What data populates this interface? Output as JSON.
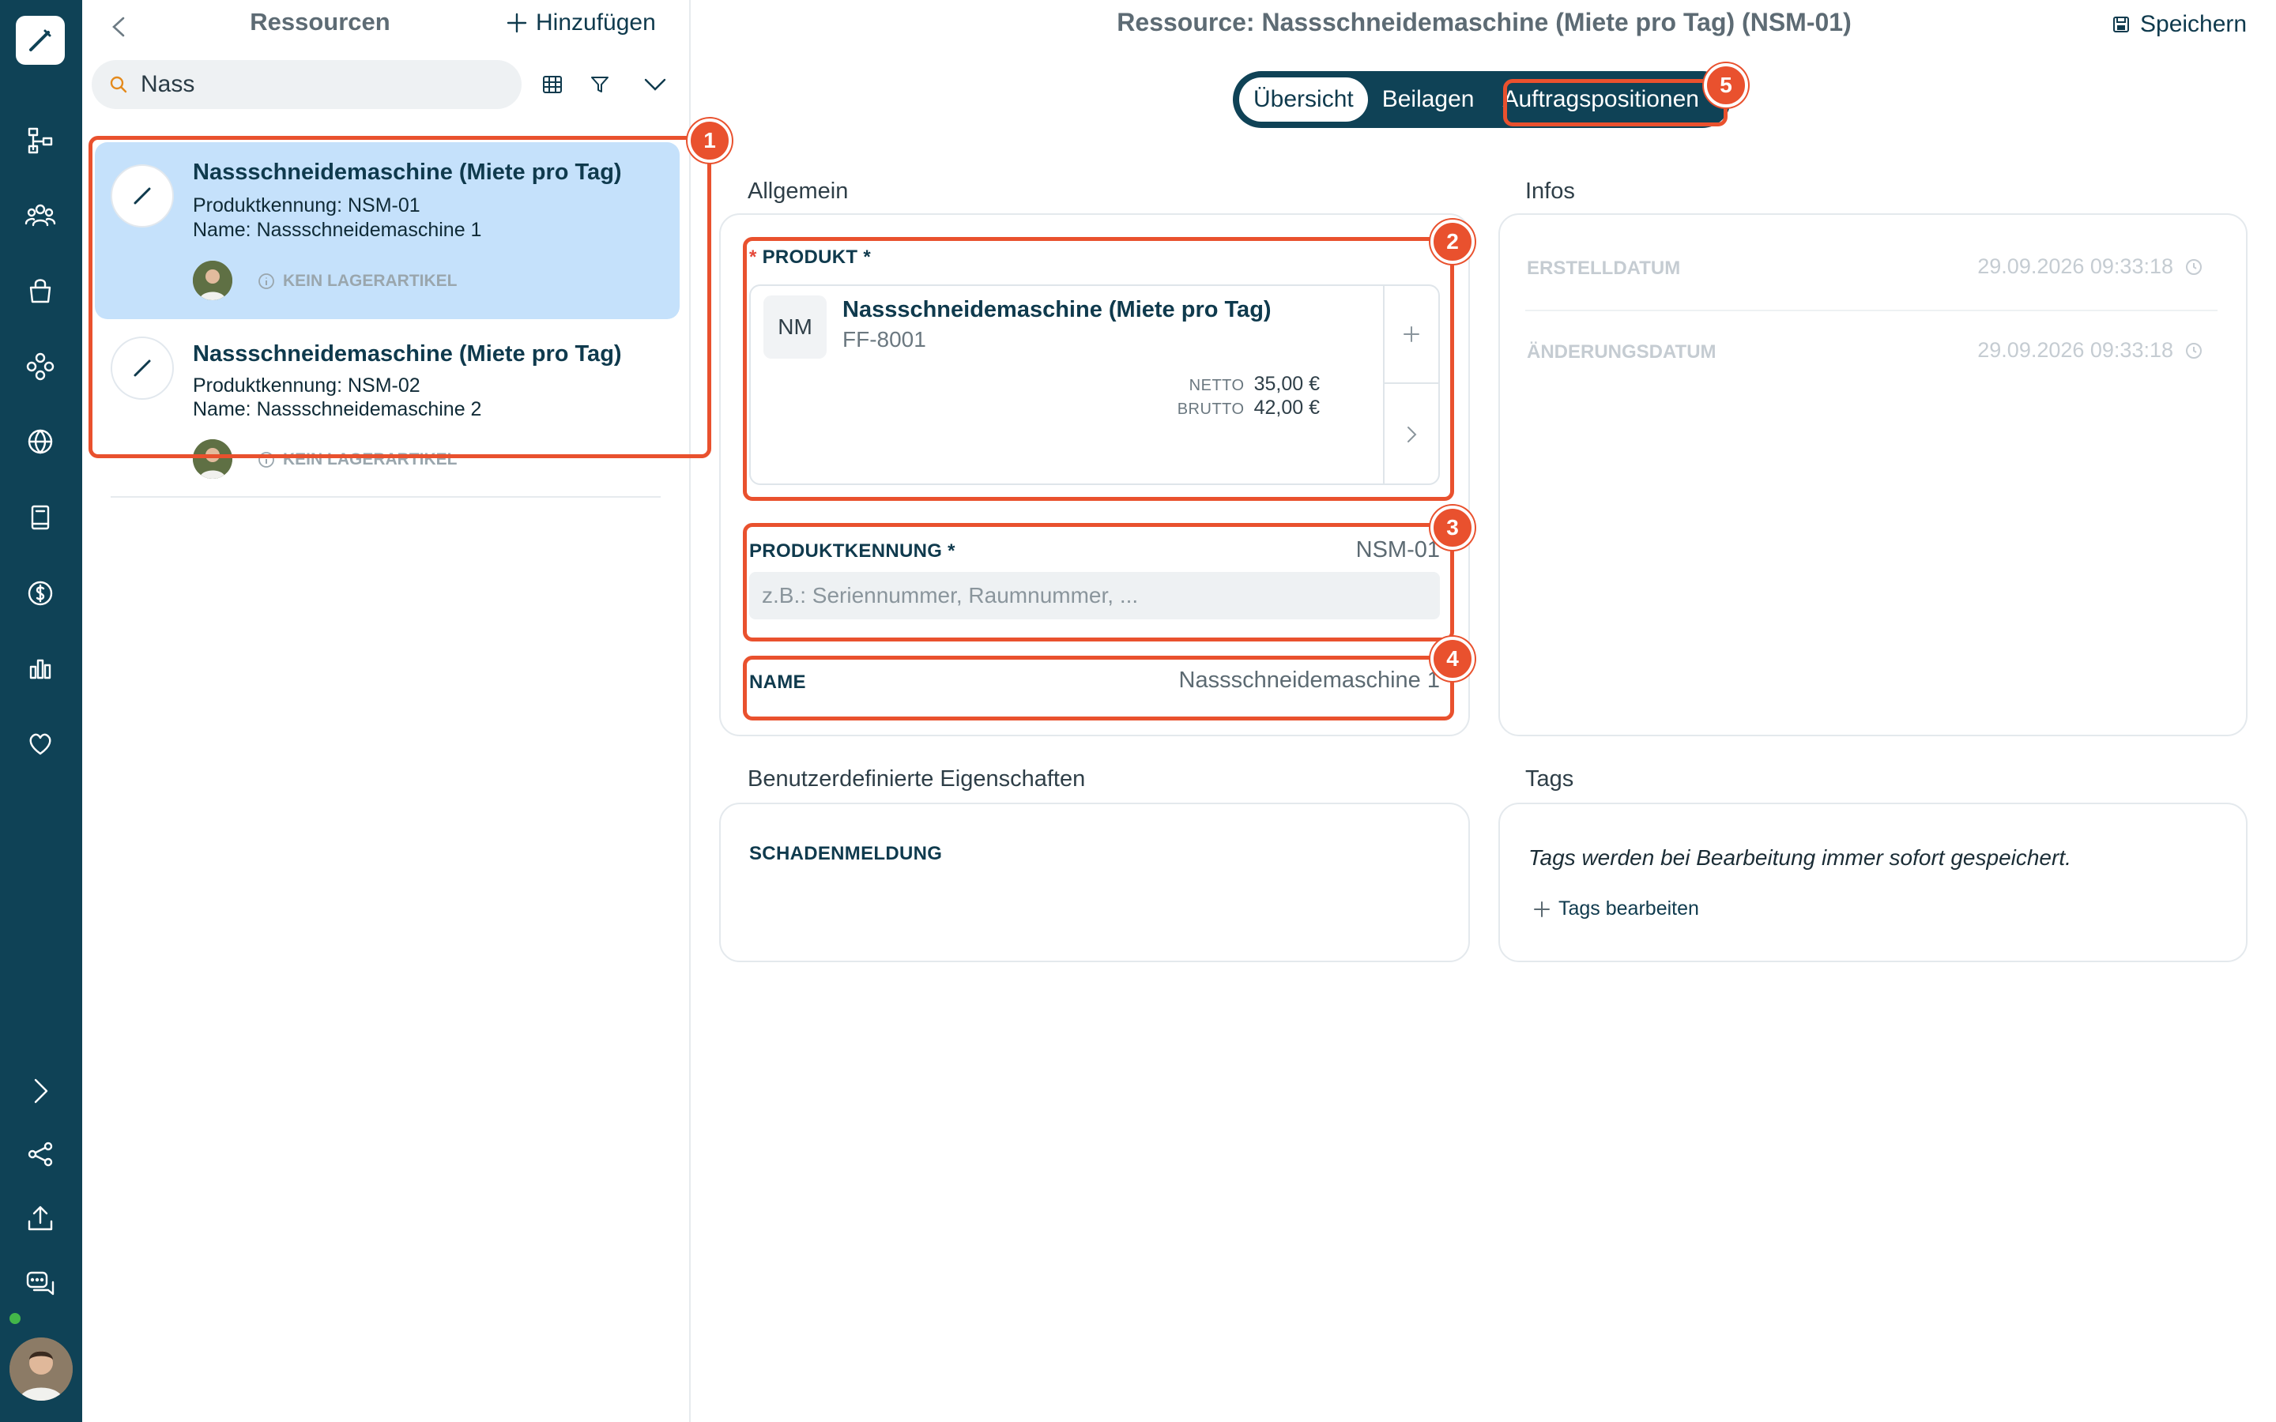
{
  "sidebar": {
    "icons": [
      "pen-icon",
      "sitemap-icon",
      "team-icon",
      "bag-icon",
      "network-icon",
      "globe-icon",
      "book-icon",
      "dollar-icon",
      "bar-chart-icon",
      "heart-icon",
      "chevron-right-icon",
      "share-icon",
      "upload-icon",
      "chat-icon"
    ]
  },
  "list_panel": {
    "title": "Ressourcen",
    "add_label": "Hinzufügen",
    "search": {
      "value": "Nass"
    },
    "items": [
      {
        "title": "Nassschneidemaschine (Miete pro Tag)",
        "product_id": "Produktkennung: NSM-01",
        "name": "Name: Nassschneidemaschine 1",
        "badge": "KEIN LAGERARTIKEL",
        "selected": true
      },
      {
        "title": "Nassschneidemaschine (Miete pro Tag)",
        "product_id": "Produktkennung: NSM-02",
        "name": "Name: Nassschneidemaschine 2",
        "badge": "KEIN LAGERARTIKEL",
        "selected": false
      }
    ]
  },
  "header": {
    "title": "Ressource: Nassschneidemaschine (Miete pro Tag) (NSM-01)",
    "save_label": "Speichern"
  },
  "tabs": [
    {
      "label": "Übersicht",
      "active": true
    },
    {
      "label": "Beilagen",
      "active": false
    },
    {
      "label": "Auftragspositionen",
      "active": false
    }
  ],
  "general": {
    "section_title": "Allgemein",
    "product_label": "PRODUKT *",
    "product": {
      "initials": "NM",
      "name": "Nassschneidemaschine (Miete pro Tag)",
      "sku": "FF-8001",
      "netto_label": "NETTO",
      "netto_value": "35,00 €",
      "brutto_label": "BRUTTO",
      "brutto_value": "42,00 €"
    },
    "product_id_label": "PRODUKTKENNUNG *",
    "product_id_value": "NSM-01",
    "product_id_placeholder": "z.B.: Seriennummer, Raumnummer, ...",
    "name_label": "NAME",
    "name_value": "Nassschneidemaschine 1"
  },
  "infos": {
    "section_title": "Infos",
    "created_label": "ERSTELLDATUM",
    "created_value": "29.09.2026 09:33:18",
    "modified_label": "ÄNDERUNGSDATUM",
    "modified_value": "29.09.2026 09:33:18"
  },
  "custom_props": {
    "section_title": "Benutzerdefinierte Eigenschaften",
    "prop_label": "SCHADENMELDUNG"
  },
  "tags": {
    "section_title": "Tags",
    "hint": "Tags werden bei Bearbeitung immer sofort gespeichert.",
    "edit_label": "Tags bearbeiten"
  },
  "annotations": [
    "1",
    "2",
    "3",
    "4",
    "5"
  ],
  "colors": {
    "rail": "#0f4256",
    "accent": "#0f3a4d",
    "selected_item": "#c5e1fb",
    "highlight": "#e9512e"
  }
}
